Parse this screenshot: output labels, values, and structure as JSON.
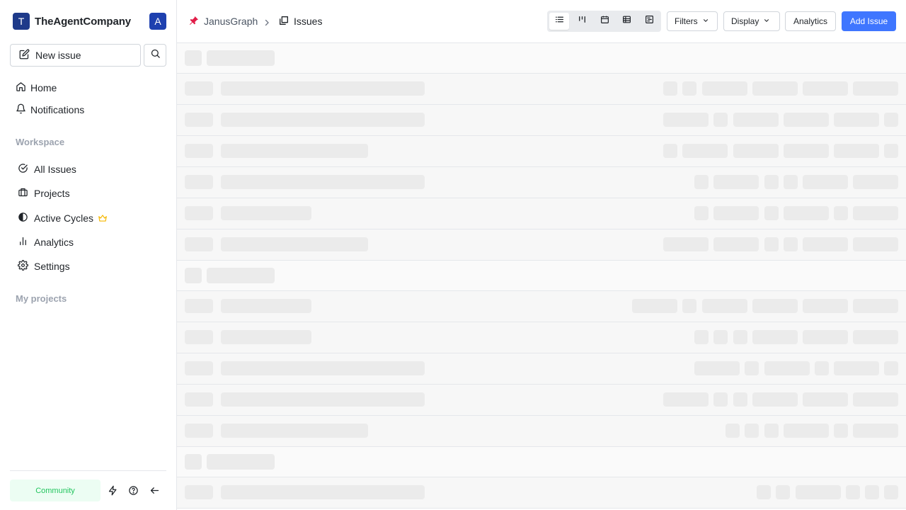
{
  "workspace": {
    "logo_letter": "T",
    "name": "TheAgentCompany",
    "avatar_letter": "A"
  },
  "sidebar": {
    "new_issue_label": "New issue",
    "top_nav": [
      {
        "label": "Home",
        "icon": "home-icon"
      },
      {
        "label": "Notifications",
        "icon": "bell-icon"
      }
    ],
    "workspace_label": "Workspace",
    "workspace_nav": [
      {
        "label": "All Issues",
        "icon": "check-circle-icon"
      },
      {
        "label": "Projects",
        "icon": "briefcase-icon"
      },
      {
        "label": "Active Cycles",
        "icon": "contrast-icon",
        "badge": "crown-icon"
      },
      {
        "label": "Analytics",
        "icon": "bar-chart-icon"
      },
      {
        "label": "Settings",
        "icon": "gear-icon"
      }
    ],
    "projects_label": "My projects",
    "community_label": "Community"
  },
  "header": {
    "project": "JanusGraph",
    "page": "Issues",
    "layouts": [
      "list",
      "kanban",
      "calendar",
      "spreadsheet",
      "gantt"
    ],
    "active_layout": "list",
    "filters_label": "Filters",
    "display_label": "Display",
    "analytics_label": "Analytics",
    "add_issue_label": "Add Issue"
  },
  "content": {
    "state": "loading"
  },
  "colors": {
    "primary": "#3f76ff",
    "workspace_logo": "#1e3a8a",
    "community_bg": "#ecfdf3",
    "community_text": "#22c55e",
    "crown": "#f5b700",
    "pin": "#e11d48"
  }
}
